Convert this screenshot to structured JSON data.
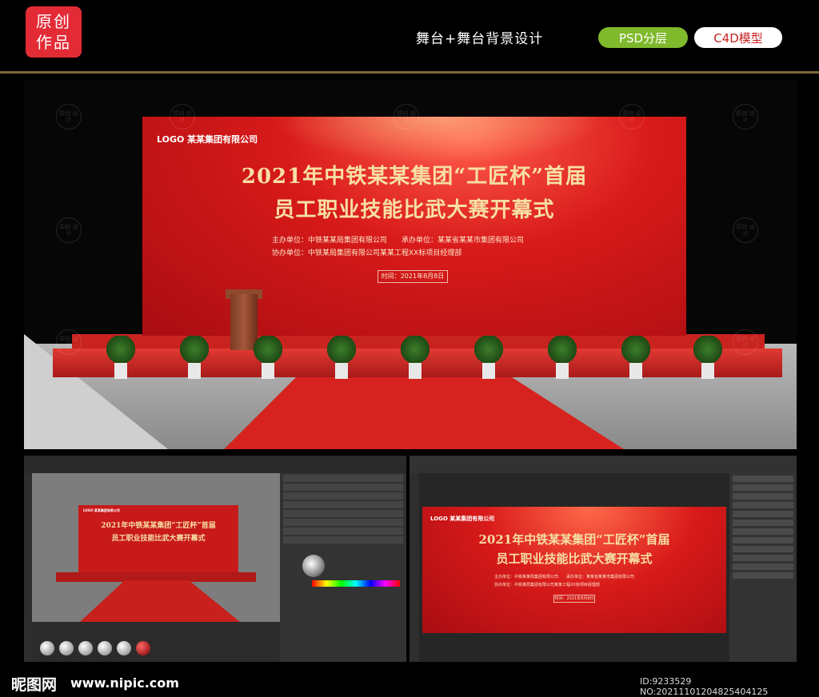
{
  "header": {
    "badge_line1": "原创",
    "badge_line2": "作品",
    "tagline": "舞台+舞台背景设计",
    "psd_tag": "PSD分层",
    "c4d_tag": "C4D模型"
  },
  "backdrop": {
    "logo": "LOGO 某某集团有限公司",
    "title_line1": "2021年中铁某某集团“工匠杯”首届",
    "title_line2": "员工职业技能比武大赛开幕式",
    "organizer": "主办单位：中铁某某局集团有限公司　　承办单位：某某省某某市集团有限公司",
    "co_organizer": "协办单位：中铁某局集团有限公司某某工程XX标项目经理部",
    "date": "时间：2021年8月8日"
  },
  "watermark": "原创\n设计",
  "footer": {
    "logo": "昵图网",
    "url": "www.nipic.com",
    "id_text": "ID:9233529 NO:20211101204825404125"
  },
  "colors": {
    "badge_red": "#e32b36",
    "psd_green": "#7fb92c",
    "stage_red": "#d81a1a",
    "gold_text": "#f7dfa4"
  }
}
